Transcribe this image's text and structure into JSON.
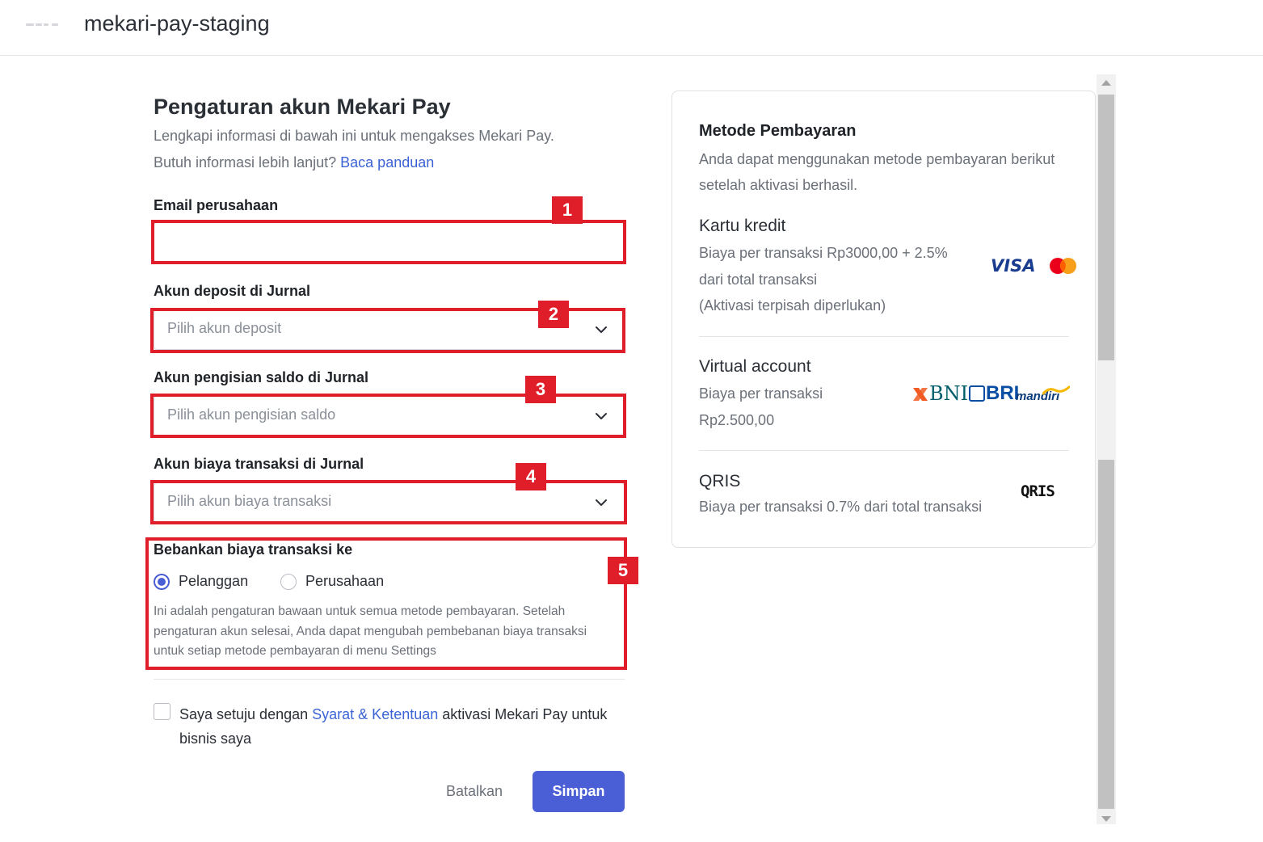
{
  "header": {
    "app_title": "mekari-pay-staging"
  },
  "form": {
    "title": "Pengaturan akun Mekari Pay",
    "subtitle_line1": "Lengkapi informasi di bawah ini untuk mengakses Mekari Pay.",
    "subtitle_line2_prefix": "Butuh informasi lebih lanjut?",
    "subtitle_link": "Baca panduan",
    "email": {
      "label": "Email perusahaan",
      "value": ""
    },
    "deposit": {
      "label": "Akun deposit di Jurnal",
      "placeholder": "Pilih akun deposit"
    },
    "topup": {
      "label": "Akun pengisian saldo di Jurnal",
      "placeholder": "Pilih akun pengisian saldo"
    },
    "fee": {
      "label": "Akun biaya transaksi di Jurnal",
      "placeholder": "Pilih akun biaya transaksi"
    },
    "charge": {
      "label": "Bebankan biaya transaksi ke",
      "options": [
        "Pelanggan",
        "Perusahaan"
      ],
      "selected": "Pelanggan",
      "help": "Ini adalah pengaturan bawaan untuk semua metode pembayaran. Setelah pengaturan akun selesai, Anda dapat mengubah pembebanan biaya transaksi untuk setiap metode pembayaran di menu Settings"
    },
    "agree": {
      "checked": false,
      "prefix": "Saya setuju dengan",
      "link": "Syarat & Ketentuan",
      "suffix": "aktivasi Mekari Pay untuk bisnis saya"
    },
    "cancel_label": "Batalkan",
    "save_label": "Simpan"
  },
  "annotations": [
    "1",
    "2",
    "3",
    "4",
    "5"
  ],
  "payment_methods": {
    "title": "Metode Pembayaran",
    "description": "Anda dapat menggunakan metode pembayaran berikut setelah aktivasi berhasil.",
    "credit_card": {
      "name": "Kartu kredit",
      "line1": "Biaya per transaksi Rp3000,00 + 2.5%",
      "line2": "dari total transaksi",
      "line3": "(Aktivasi terpisah diperlukan)",
      "logos": [
        "VISA",
        "mastercard"
      ]
    },
    "virtual_account": {
      "name": "Virtual account",
      "line1": "Biaya per transaksi",
      "line2": "Rp2.500,00",
      "logos": [
        "BNI",
        "BRI",
        "mandiri"
      ]
    },
    "qris": {
      "name": "QRIS",
      "line1": "Biaya per transaksi 0.7% dari total transaksi",
      "logo": "QRIS"
    }
  },
  "colors": {
    "primary": "#4a5fd6",
    "link": "#3b63d6",
    "annotation": "#e01e2a"
  }
}
